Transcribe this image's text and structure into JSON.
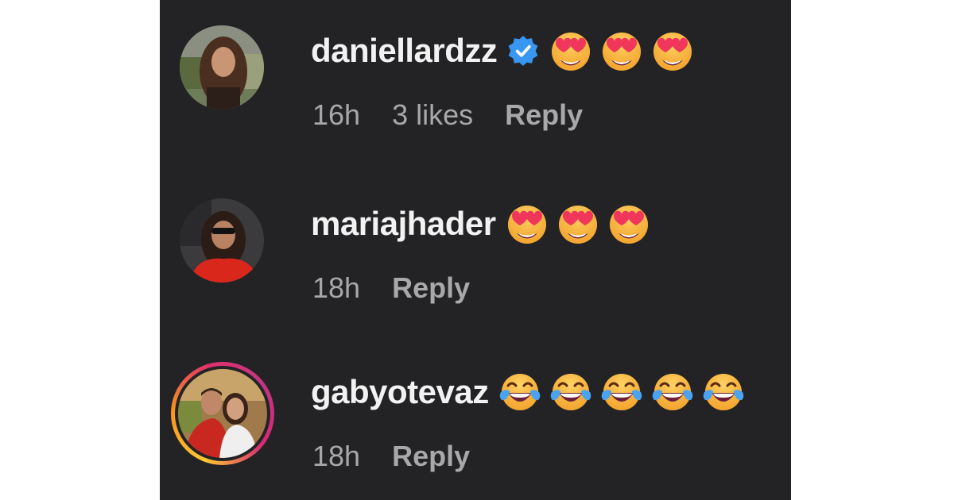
{
  "comments": [
    {
      "username": "daniellardzz",
      "verified": true,
      "emoji_icons": [
        "heart-eyes-emoji",
        "heart-eyes-emoji",
        "heart-eyes-emoji"
      ],
      "time": "16h",
      "likes": "3 likes",
      "reply_label": "Reply"
    },
    {
      "username": "mariajhader",
      "verified": false,
      "emoji_icons": [
        "heart-eyes-emoji",
        "heart-eyes-emoji",
        "heart-eyes-emoji"
      ],
      "time": "18h",
      "reply_label": "Reply"
    },
    {
      "username": "gabyotevaz",
      "verified": false,
      "has_story_ring": true,
      "emoji_icons": [
        "tears-of-joy-emoji",
        "tears-of-joy-emoji",
        "tears-of-joy-emoji",
        "tears-of-joy-emoji",
        "tears-of-joy-emoji"
      ],
      "time": "18h",
      "reply_label": "Reply"
    }
  ],
  "colors": {
    "panel_bg": "#232326",
    "username": "#f2f2f2",
    "meta": "#a8a8a8",
    "verified_badge": "#3897f0"
  }
}
